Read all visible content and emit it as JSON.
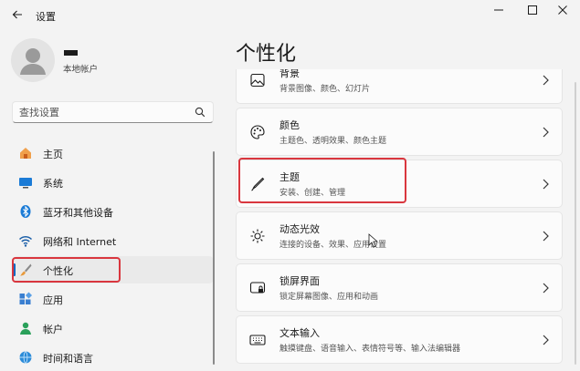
{
  "app": {
    "title": "设置"
  },
  "profile": {
    "account_type": "本地帐户"
  },
  "search": {
    "placeholder": "查找设置"
  },
  "nav": {
    "items": [
      {
        "label": "主页",
        "icon": "home-icon"
      },
      {
        "label": "系统",
        "icon": "monitor-icon"
      },
      {
        "label": "蓝牙和其他设备",
        "icon": "bluetooth-icon"
      },
      {
        "label": "网络和 Internet",
        "icon": "wifi-icon"
      },
      {
        "label": "个性化",
        "icon": "brush-icon",
        "selected": true
      },
      {
        "label": "应用",
        "icon": "apps-icon"
      },
      {
        "label": "帐户",
        "icon": "account-icon"
      },
      {
        "label": "时间和语言",
        "icon": "globe-icon"
      }
    ]
  },
  "main": {
    "page_title": "个性化",
    "cards": [
      {
        "title": "背景",
        "desc": "背景图像、颜色、幻灯片",
        "icon": "image-icon"
      },
      {
        "title": "颜色",
        "desc": "主题色、透明效果、颜色主题",
        "icon": "palette-icon"
      },
      {
        "title": "主题",
        "desc": "安装、创建、管理",
        "icon": "pen-icon"
      },
      {
        "title": "动态光效",
        "desc": "连接的设备、效果、应用设置",
        "icon": "light-icon"
      },
      {
        "title": "锁屏界面",
        "desc": "锁定屏幕图像、应用和动画",
        "icon": "lockscreen-icon"
      },
      {
        "title": "文本输入",
        "desc": "触摸键盘、语音输入、表情符号等、输入法编辑器",
        "icon": "keyboard-icon"
      }
    ]
  },
  "colors": {
    "accent": "#0067c0",
    "highlight": "#d9363e",
    "background": "#f3f3f3",
    "card": "#fbfbfb"
  }
}
